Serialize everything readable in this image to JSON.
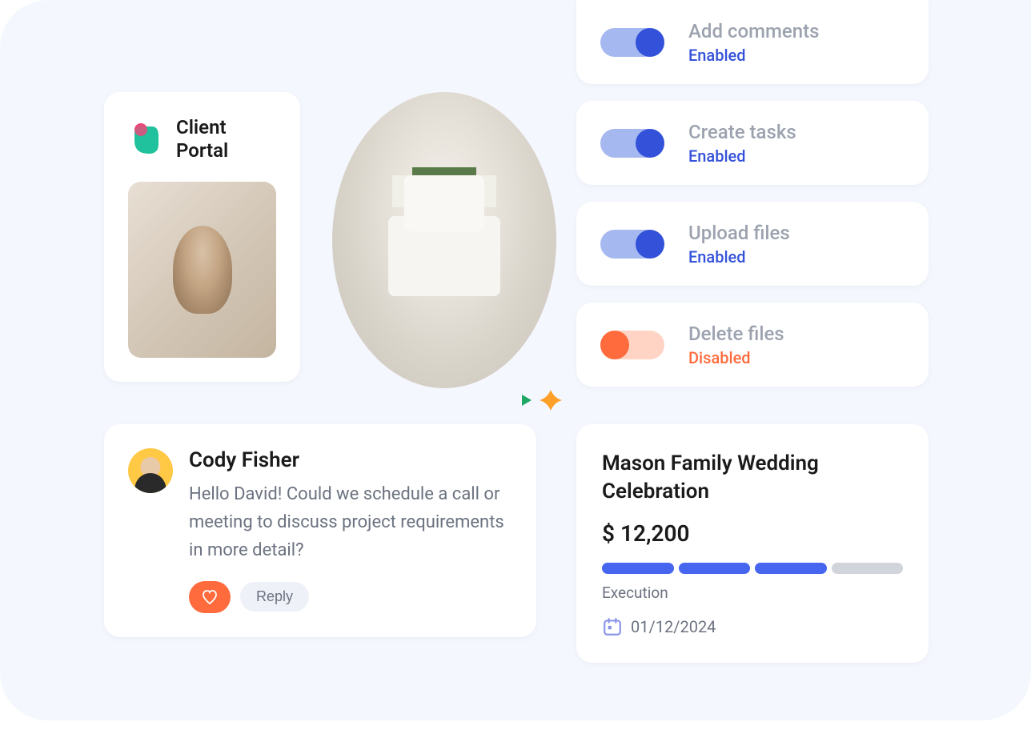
{
  "portal": {
    "title": "Client Portal"
  },
  "permissions": [
    {
      "label": "Add comments",
      "status": "Enabled",
      "on": true
    },
    {
      "label": "Create tasks",
      "status": "Enabled",
      "on": true
    },
    {
      "label": "Upload files",
      "status": "Enabled",
      "on": true
    },
    {
      "label": "Delete files",
      "status": "Disabled",
      "on": false
    }
  ],
  "comment": {
    "author": "Cody Fisher",
    "text": "Hello David! Could we schedule a call or meeting to discuss project requirements in more detail?",
    "reply_label": "Reply"
  },
  "project": {
    "title": "Mason Family Wedding Celebration",
    "amount": "$ 12,200",
    "phase": "Execution",
    "date": "01/12/2024",
    "progress_segments": 4,
    "progress_filled": 3
  }
}
